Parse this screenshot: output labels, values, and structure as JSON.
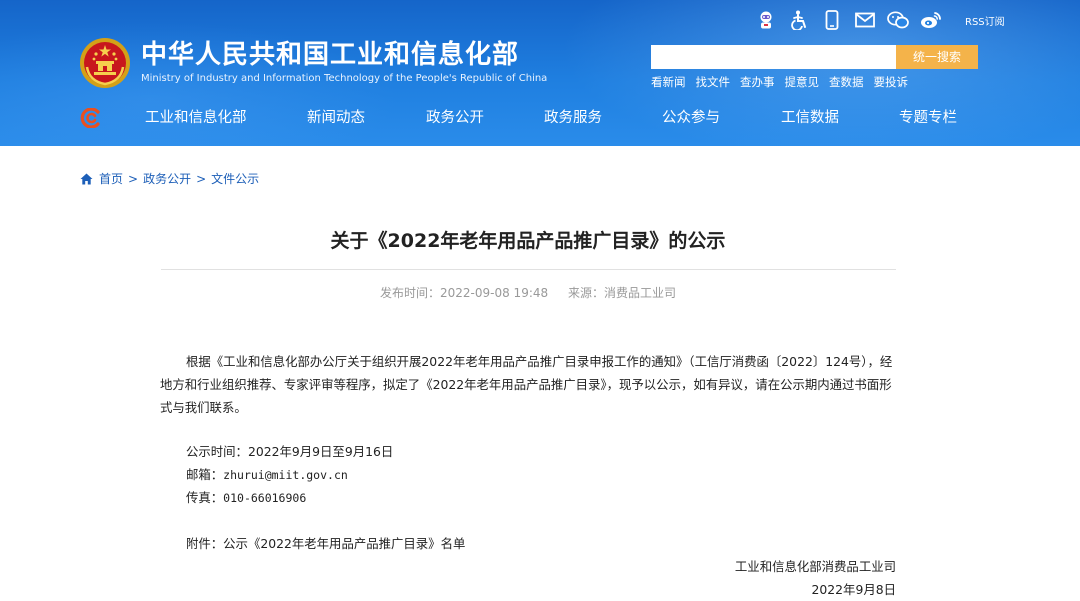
{
  "header": {
    "title_cn": "中华人民共和国工业和信息化部",
    "title_en": "Ministry of Industry and Information Technology of the People's Republic of China",
    "rss_label": "RSS订阅",
    "search": {
      "value": "",
      "placeholder": "",
      "button_label": "统一搜索"
    },
    "quick_links": [
      "看新闻",
      "找文件",
      "查办事",
      "提意见",
      "查数据",
      "要投诉"
    ],
    "nav": [
      "工业和信息化部",
      "新闻动态",
      "政务公开",
      "政务服务",
      "公众参与",
      "工信数据",
      "专题专栏"
    ],
    "colors": {
      "header_blue": "#1f7fe0",
      "search_button": "#f4b34a",
      "breadcrumb_link": "#1d5fb8"
    },
    "icons": [
      "robot-icon",
      "accessibility-icon",
      "mobile-icon",
      "mail-icon",
      "wechat-icon",
      "weibo-icon",
      "rss-icon"
    ]
  },
  "breadcrumb": [
    "首页",
    "政务公开",
    "文件公示"
  ],
  "article": {
    "title": "关于《2022年老年用品产品推广目录》的公示",
    "publish_time": "发布时间：2022-09-08 19:48",
    "source": "来源：消费品工业司",
    "paragraph1": "根据《工业和信息化部办公厅关于组织开展2022年老年用品产品推广目录申报工作的通知》（工信厅消费函〔2022〕124号），经地方和行业组织推荐、专家评审等程序，拟定了《2022年老年用品产品推广目录》，现予以公示，如有异议，请在公示期内通过书面形式与我们联系。",
    "period_label": "公示时间：",
    "period_value": "2022年9月9日至9月16日",
    "email_label": "邮箱：",
    "email_value": "zhurui@miit.gov.cn",
    "fax_label": "传真：",
    "fax_value": "010-66016906",
    "attachment": "附件：公示《2022年老年用品产品推广目录》名单",
    "signature_org": "工业和信息化部消费品工业司",
    "signature_date": "2022年9月8日"
  }
}
